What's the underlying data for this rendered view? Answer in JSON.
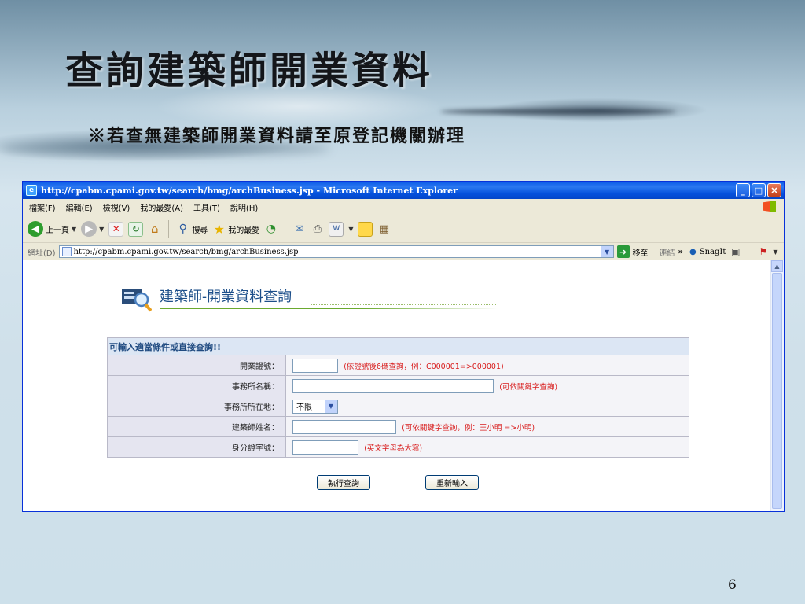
{
  "slide": {
    "title": "查詢建築師開業資料",
    "subtitle": "※若查無建築師開業資料請至原登記機關辦理",
    "page_number": "6"
  },
  "window": {
    "title": "http://cpabm.cpami.gov.tw/search/bmg/archBusiness.jsp - Microsoft Internet Explorer",
    "minimize": "_",
    "maximize": "□",
    "close": "✕"
  },
  "menu": [
    "檔案(F)",
    "編輯(E)",
    "檢視(V)",
    "我的最愛(A)",
    "工具(T)",
    "說明(H)"
  ],
  "toolbar": {
    "back_label": "上一頁",
    "search_label": "搜尋",
    "favorites_label": "我的最愛"
  },
  "address": {
    "label": "網址(D)",
    "url": "http://cpabm.cpami.gov.tw/search/bmg/archBusiness.jsp",
    "go_label": "移至",
    "links_label": "連結",
    "more": "»",
    "snagit_label": "SnagIt"
  },
  "page": {
    "header_title": "建築師-開業資料查詢",
    "form_caption": "可輸入適當條件或直接查詢!!",
    "rows": [
      {
        "label": "開業證號：",
        "hint": "(依證號後6碼查詢，例：C000001=>000001)"
      },
      {
        "label": "事務所名稱：",
        "hint": "(可依關鍵字查詢)"
      },
      {
        "label": "事務所所在地：",
        "select_value": "不限"
      },
      {
        "label": "建築師姓名：",
        "hint": "(可依關鍵字查詢，例：王小明 =>小明)"
      },
      {
        "label": "身分證字號：",
        "hint": "(英文字母為大寫)"
      }
    ],
    "submit_label": "執行查詢",
    "reset_label": "重新輸入"
  },
  "colors": {
    "titlebar": "#0a5ae8",
    "hint_red": "#d81b1b",
    "label_bg": "#e5e5f0",
    "caption_bg": "#dce6f4"
  }
}
